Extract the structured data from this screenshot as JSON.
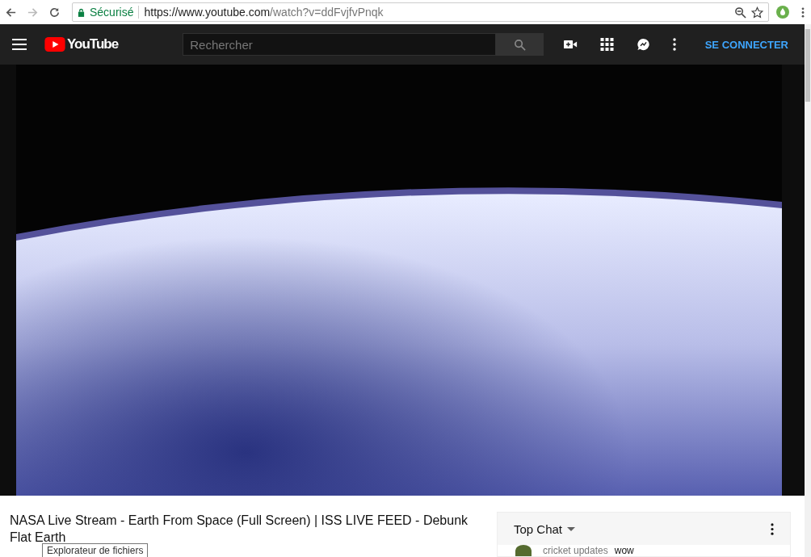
{
  "browser": {
    "security_label": "Sécurisé",
    "url_host": "https://www.youtube.com",
    "url_path": "/watch?v=ddFvjfvPnqk"
  },
  "header": {
    "logo_text": "YouTube",
    "search": {
      "placeholder": "Rechercher"
    },
    "sign_in": "SE CONNECTER"
  },
  "video": {
    "title": "NASA Live Stream - Earth From Space (Full Screen) | ISS LIVE FEED - Debunk Flat Earth"
  },
  "chat": {
    "mode": "Top Chat",
    "messages": [
      {
        "author": "cricket updates",
        "text": "wow"
      }
    ]
  },
  "tooltip": {
    "text": "Explorateur de fichiers"
  }
}
